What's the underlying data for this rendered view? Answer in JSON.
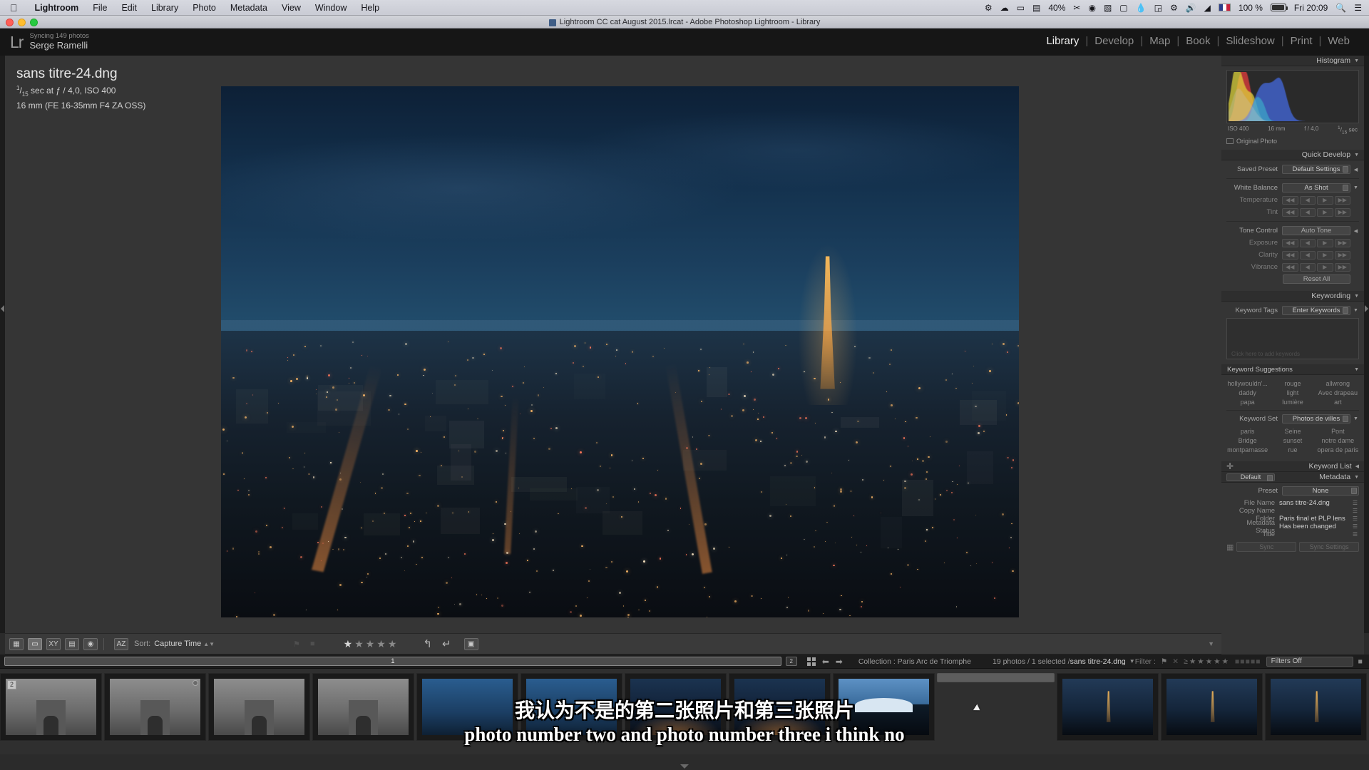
{
  "macmenu": {
    "apple": "apple-logo",
    "items": [
      "Lightroom",
      "File",
      "Edit",
      "Library",
      "Photo",
      "Metadata",
      "View",
      "Window",
      "Help"
    ],
    "status": {
      "battery_percent": "100 %",
      "display_percent": "40%",
      "clock": "Fri 20:09",
      "flag": "french-flag"
    }
  },
  "window": {
    "title": "Lightroom CC cat August 2015.lrcat - Adobe Photoshop Lightroom - Library"
  },
  "identity": {
    "logo": "Lr",
    "sync_status": "Syncing 149 photos",
    "user": "Serge Ramelli"
  },
  "modules": {
    "items": [
      "Library",
      "Develop",
      "Map",
      "Book",
      "Slideshow",
      "Print",
      "Web"
    ],
    "active": "Library"
  },
  "photo_info": {
    "filename": "sans titre-24.dng",
    "exposure_num": "1",
    "exposure_den": "15",
    "exposure_rest": " sec at ƒ / 4,0, ISO 400",
    "lens": "16 mm (FE 16-35mm F4 ZA OSS)"
  },
  "histogram": {
    "title": "Histogram",
    "iso": "ISO 400",
    "focal": "16 mm",
    "aperture": "f / 4,0",
    "shutter_num": "1",
    "shutter_den": "15",
    "shutter_unit": " sec",
    "original_photo": "Original Photo"
  },
  "quick_develop": {
    "title": "Quick Develop",
    "saved_preset_label": "Saved Preset",
    "saved_preset_value": "Default Settings",
    "white_balance_label": "White Balance",
    "white_balance_value": "As Shot",
    "temperature_label": "Temperature",
    "tint_label": "Tint",
    "tone_control_label": "Tone Control",
    "auto_tone": "Auto Tone",
    "exposure_label": "Exposure",
    "clarity_label": "Clarity",
    "vibrance_label": "Vibrance",
    "reset_all": "Reset All",
    "step_marks": [
      "◀◀",
      "◀",
      "▶",
      "▶▶"
    ]
  },
  "keywording": {
    "title": "Keywording",
    "tags_label": "Keyword Tags",
    "tags_value": "Enter Keywords",
    "placeholder_hint": "Click here to add keywords",
    "suggestions_title": "Keyword Suggestions",
    "suggestions": [
      "hollywouldn'...",
      "rouge",
      "allwrong",
      "daddy",
      "light",
      "Avec drapeau",
      "papa",
      "lumière",
      "art"
    ],
    "set_label": "Keyword Set",
    "set_value": "Photos de villes",
    "set_keywords": [
      "paris",
      "Seine",
      "Pont",
      "Bridge",
      "sunset",
      "notre dame",
      "montparnasse",
      "rue",
      "opera de paris"
    ],
    "keyword_list_title": "Keyword List"
  },
  "metadata": {
    "title": "Metadata",
    "view_preset": "Default",
    "preset_label": "Preset",
    "preset_value": "None",
    "fields": [
      {
        "label": "File Name",
        "value": "sans titre-24.dng"
      },
      {
        "label": "Copy Name",
        "value": ""
      },
      {
        "label": "Folder",
        "value": "Paris final et PLP lens"
      },
      {
        "label": "Metadata Status",
        "value": "Has been changed"
      },
      {
        "label": "Title",
        "value": ""
      }
    ],
    "sync_button": "Sync",
    "sync_settings_button": "Sync Settings"
  },
  "toolbar": {
    "views": [
      "grid-view",
      "loupe-view",
      "compare-view",
      "survey-view",
      "people-view"
    ],
    "sort_label": "Sort:",
    "sort_value": "Capture Time",
    "rating_filled": 1,
    "rating_total": 5
  },
  "filmstrip_bar": {
    "page_buttons": [
      "1",
      "2"
    ],
    "collection_label": "Collection : Paris Arc de Triomphe",
    "count_text": "19 photos / 1 selected / ",
    "current_file": "sans titre-24.dng",
    "filter_label": "Filter :",
    "filters_value": "Filters Off"
  },
  "filmstrip": {
    "thumbnails": [
      {
        "kind": "t-arc",
        "badge": "2",
        "selected": false
      },
      {
        "kind": "t-arc",
        "badge": "",
        "dot": true,
        "selected": false
      },
      {
        "kind": "t-arc",
        "badge": "",
        "selected": false
      },
      {
        "kind": "t-arc",
        "badge": "",
        "selected": false
      },
      {
        "kind": "t-blue",
        "badge": "",
        "selected": false
      },
      {
        "kind": "t-blue",
        "badge": "",
        "selected": false
      },
      {
        "kind": "t-night",
        "badge": "",
        "selected": false
      },
      {
        "kind": "t-night",
        "badge": "",
        "selected": false
      },
      {
        "kind": "t-dome",
        "badge": "",
        "selected": false
      },
      {
        "kind": "t-night",
        "badge": "",
        "selected": true
      },
      {
        "kind": "t-eiffel",
        "badge": "",
        "selected": false
      },
      {
        "kind": "t-eiffel",
        "badge": "",
        "selected": false
      },
      {
        "kind": "t-eiffel",
        "badge": "",
        "selected": false
      }
    ]
  },
  "subtitles": {
    "chinese": "我认为不是的第二张照片和第三张照片",
    "english": "photo number two and photo number three i think no"
  },
  "colors": {
    "panel_bg": "#353535",
    "panel_header": "#2e2e2e",
    "app_bg": "#2b2b2b",
    "accent_text": "#f2f2f2"
  }
}
